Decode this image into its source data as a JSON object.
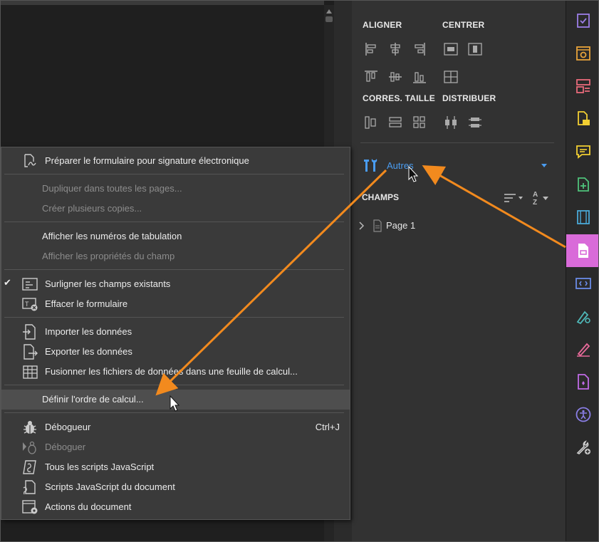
{
  "panel": {
    "align_title": "ALIGNER",
    "center_title": "CENTRER",
    "size_title": "CORRES. TAILLE",
    "distribute_title": "DISTRIBUER",
    "others_label": "Autres",
    "fields_title": "CHAMPS",
    "page_label": "Page 1"
  },
  "menu": {
    "items": [
      {
        "label": "Préparer le formulaire pour signature électronique",
        "disabled": false
      },
      {
        "label": "Dupliquer dans toutes les pages...",
        "disabled": true
      },
      {
        "label": "Créer plusieurs copies...",
        "disabled": true
      },
      {
        "label": "Afficher les numéros de tabulation",
        "disabled": false
      },
      {
        "label": "Afficher les propriétés du champ",
        "disabled": true
      },
      {
        "label": "Surligner les champs existants",
        "disabled": false,
        "checked": true
      },
      {
        "label": "Effacer le formulaire",
        "disabled": false
      },
      {
        "label": "Importer les données",
        "disabled": false
      },
      {
        "label": "Exporter les données",
        "disabled": false
      },
      {
        "label": "Fusionner les fichiers de données dans une feuille de calcul...",
        "disabled": false
      },
      {
        "label": "Définir l'ordre de calcul...",
        "disabled": false,
        "highlighted": true
      },
      {
        "label": "Débogueur",
        "disabled": false,
        "shortcut": "Ctrl+J"
      },
      {
        "label": "Déboguer",
        "disabled": true
      },
      {
        "label": "Tous les scripts JavaScript",
        "disabled": false
      },
      {
        "label": "Scripts JavaScript du document",
        "disabled": false
      },
      {
        "label": "Actions du document",
        "disabled": false
      }
    ],
    "check_mark": "✔"
  },
  "colors": {
    "accent_blue": "#4a9cf0",
    "arrow_orange": "#f28a1e",
    "active_tool": "#d96bd9"
  },
  "toolstrip_icons": [
    "fill-sign-icon",
    "organize-icon",
    "layout-icon",
    "export-icon",
    "comment-icon",
    "create-pdf-icon",
    "media-icon",
    "prepare-form-icon",
    "javascript-icon",
    "signature-icon",
    "draw-icon",
    "protect-icon",
    "accessibility-icon",
    "tools-icon"
  ]
}
